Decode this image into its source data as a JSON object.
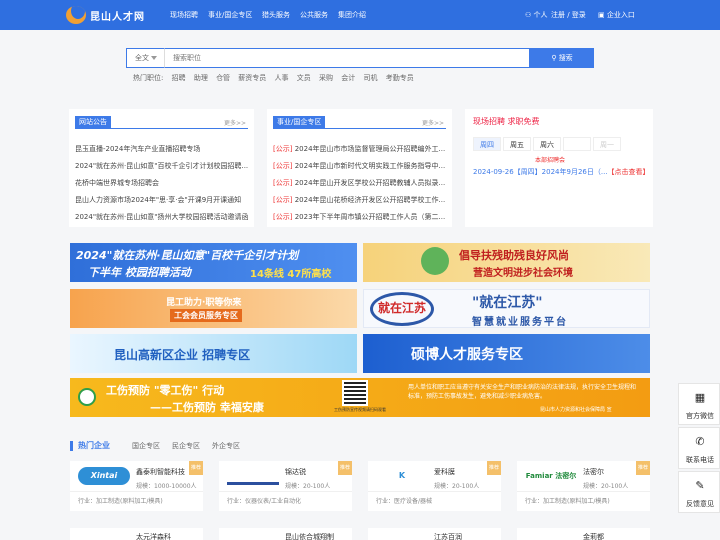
{
  "header": {
    "logo_text": "昆山人才网",
    "nav": [
      "现场招聘",
      "事业/国企专区",
      "猎头服务",
      "公共服务",
      "集团介绍"
    ],
    "personal": "个人",
    "login_register": "注册 / 登录",
    "enterprise": "企业入口"
  },
  "search": {
    "category": "全文",
    "placeholder": "搜索职位",
    "button": "搜索"
  },
  "hot_positions": {
    "label": "热门职位:",
    "items": [
      "招聘",
      "助理",
      "仓管",
      "薪资专员",
      "人事",
      "文员",
      "采购",
      "会计",
      "司机",
      "考勤专员"
    ]
  },
  "notice": {
    "title": "网站公告",
    "more": "更多>>",
    "items": [
      "昆玉直播-2024年汽车产业直播招聘专场",
      "2024\"就在苏州·昆山如意\"百校千企引才计划校园招聘...",
      "花桥中端世界城专场招聘会",
      "昆山人力资源市场2024年\"思·享·会\"开课9月开课通知",
      "2024\"就在苏州·昆山如意\"扬州大学校园招聘活动邀请函"
    ]
  },
  "gov": {
    "title": "事业/国企专区",
    "more": "更多>>",
    "items": [
      {
        "tag": "[公示]",
        "text": "2024年昆山市市场监督管理局公开招聘编外工..."
      },
      {
        "tag": "[公示]",
        "text": "2024年昆山市新时代文明实践工作服务指导中..."
      },
      {
        "tag": "[公示]",
        "text": "2024年昆山开发区学校公开招聘教辅人员拟录..."
      },
      {
        "tag": "[公示]",
        "text": "2024年昆山花桥经济开发区公开招聘学校工作..."
      },
      {
        "tag": "[公示]",
        "text": "2023年下半年周市镇公开招聘工作人员（第二..."
      }
    ]
  },
  "onsite": {
    "title": "现场招聘 求职免费",
    "days": [
      "周四",
      "周五",
      "周六",
      "",
      "周一"
    ],
    "sub": "本部招聘会",
    "date": "2024-09-26【周四】2024年9月26日（...",
    "link": "【点击查看】"
  },
  "banners": [
    {
      "line1": "2024\"就在苏州·昆山如意\"百校千企引才计划",
      "line2": "下半年 校园招聘活动",
      "line3": "14条线 47所高校"
    },
    {
      "line1": "倡导扶残助残良好风尚",
      "line2": "营造文明进步社会环境"
    },
    {
      "line1": "昆工助力·职等你来",
      "line2": "工会会员服务专区"
    },
    {
      "line1": "就在江苏",
      "line2": "\"就在江苏\"",
      "line3": "智慧就业服务平台"
    },
    {
      "line1": "昆山高新区企业 招聘专区"
    },
    {
      "line1": "硕博人才服务专区"
    },
    {
      "line1": "工伤预防 \"零工伤\" 行动",
      "line2": "——工伤预防 幸福安康",
      "qr": "工伤预防宣传视频请扫码观看",
      "side1": "用人单位和职工应当遵守有关安全生产和职业病防治的法律法规，执行安全卫生规程和标准，预防工伤事故发生，避免和减少职业病危害。",
      "side2": "昆山市人力资源和社会保障局 宣"
    }
  ],
  "hot_ent": {
    "title": "热门企业",
    "tabs": [
      "国企专区",
      "民企专区",
      "外企专区"
    ],
    "items": [
      {
        "logo": "Xintai",
        "name": "鑫泰利智能科技",
        "size": "规模：1000-10000人",
        "industry": "行业：加工制造(原料加工/模具)",
        "ribbon": "推荐"
      },
      {
        "logo": "",
        "name": "锦达锐",
        "size": "规模：20-100人",
        "industry": "行业：仪器仪表/工业自动化",
        "ribbon": "推荐"
      },
      {
        "logo": "K",
        "name": "爱科膜",
        "size": "规模：20-100人",
        "industry": "行业：医疗设备/器械",
        "ribbon": "推荐"
      },
      {
        "logo": "Famiar 法密尔",
        "name": "法密尔",
        "size": "规模：20-100人",
        "industry": "行业：加工制造(原料加工/模具)",
        "ribbon": "推荐"
      }
    ],
    "row2": [
      "太元洋森科",
      "昆山依合城翔制",
      "江苏百润",
      "金莉都"
    ]
  },
  "side_tools": [
    "官方微信",
    "联系电话",
    "反馈意见"
  ],
  "colors": {
    "primary": "#2f6fe0",
    "accent": "#3d7ae8",
    "red": "#e33"
  }
}
